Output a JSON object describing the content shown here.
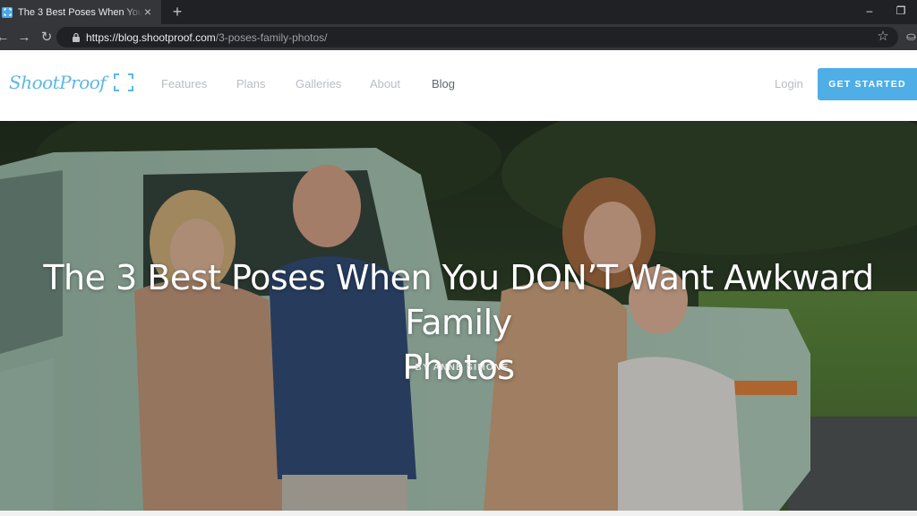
{
  "browser": {
    "tab_title": "The 3 Best Poses When You DON'T Want Awkward Family Photos",
    "tab_close": "×",
    "new_tab": "+",
    "minimize": "–",
    "restore": "❐",
    "back": "←",
    "forward": "→",
    "reload": "↻",
    "url_host": "https://blog.shootproof.com",
    "url_path": "/3-poses-family-photos/",
    "star": "☆",
    "extension": "⛀"
  },
  "site": {
    "logo_text": "ShootProof",
    "nav": [
      "Features",
      "Plans",
      "Galleries",
      "About",
      "Blog"
    ],
    "active_nav": "Blog",
    "login": "Login",
    "cta": "GET STARTED",
    "brand_color": "#50aee6"
  },
  "hero": {
    "title_line1": "The 3 Best Poses When You DON’T Want Awkward Family",
    "title_line2": "Photos",
    "byline": "BY ANNE SIMONE"
  },
  "icons": {
    "lock": "lock-icon",
    "star": "star-icon",
    "favicon": "shootproof-favicon-icon"
  }
}
